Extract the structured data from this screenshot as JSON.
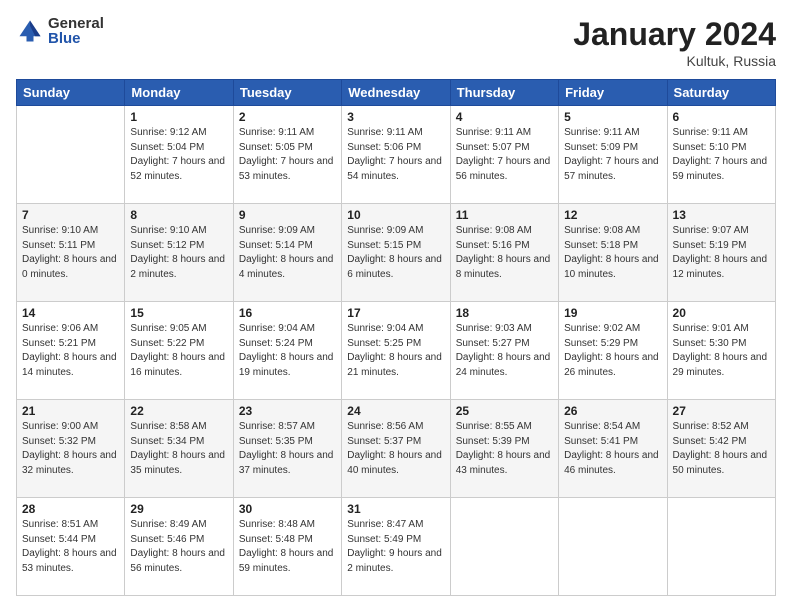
{
  "header": {
    "logo_general": "General",
    "logo_blue": "Blue",
    "month_title": "January 2024",
    "location": "Kultuk, Russia"
  },
  "days_of_week": [
    "Sunday",
    "Monday",
    "Tuesday",
    "Wednesday",
    "Thursday",
    "Friday",
    "Saturday"
  ],
  "weeks": [
    [
      {
        "day": "",
        "sunrise": "",
        "sunset": "",
        "daylight": ""
      },
      {
        "day": "1",
        "sunrise": "Sunrise: 9:12 AM",
        "sunset": "Sunset: 5:04 PM",
        "daylight": "Daylight: 7 hours and 52 minutes."
      },
      {
        "day": "2",
        "sunrise": "Sunrise: 9:11 AM",
        "sunset": "Sunset: 5:05 PM",
        "daylight": "Daylight: 7 hours and 53 minutes."
      },
      {
        "day": "3",
        "sunrise": "Sunrise: 9:11 AM",
        "sunset": "Sunset: 5:06 PM",
        "daylight": "Daylight: 7 hours and 54 minutes."
      },
      {
        "day": "4",
        "sunrise": "Sunrise: 9:11 AM",
        "sunset": "Sunset: 5:07 PM",
        "daylight": "Daylight: 7 hours and 56 minutes."
      },
      {
        "day": "5",
        "sunrise": "Sunrise: 9:11 AM",
        "sunset": "Sunset: 5:09 PM",
        "daylight": "Daylight: 7 hours and 57 minutes."
      },
      {
        "day": "6",
        "sunrise": "Sunrise: 9:11 AM",
        "sunset": "Sunset: 5:10 PM",
        "daylight": "Daylight: 7 hours and 59 minutes."
      }
    ],
    [
      {
        "day": "7",
        "sunrise": "Sunrise: 9:10 AM",
        "sunset": "Sunset: 5:11 PM",
        "daylight": "Daylight: 8 hours and 0 minutes."
      },
      {
        "day": "8",
        "sunrise": "Sunrise: 9:10 AM",
        "sunset": "Sunset: 5:12 PM",
        "daylight": "Daylight: 8 hours and 2 minutes."
      },
      {
        "day": "9",
        "sunrise": "Sunrise: 9:09 AM",
        "sunset": "Sunset: 5:14 PM",
        "daylight": "Daylight: 8 hours and 4 minutes."
      },
      {
        "day": "10",
        "sunrise": "Sunrise: 9:09 AM",
        "sunset": "Sunset: 5:15 PM",
        "daylight": "Daylight: 8 hours and 6 minutes."
      },
      {
        "day": "11",
        "sunrise": "Sunrise: 9:08 AM",
        "sunset": "Sunset: 5:16 PM",
        "daylight": "Daylight: 8 hours and 8 minutes."
      },
      {
        "day": "12",
        "sunrise": "Sunrise: 9:08 AM",
        "sunset": "Sunset: 5:18 PM",
        "daylight": "Daylight: 8 hours and 10 minutes."
      },
      {
        "day": "13",
        "sunrise": "Sunrise: 9:07 AM",
        "sunset": "Sunset: 5:19 PM",
        "daylight": "Daylight: 8 hours and 12 minutes."
      }
    ],
    [
      {
        "day": "14",
        "sunrise": "Sunrise: 9:06 AM",
        "sunset": "Sunset: 5:21 PM",
        "daylight": "Daylight: 8 hours and 14 minutes."
      },
      {
        "day": "15",
        "sunrise": "Sunrise: 9:05 AM",
        "sunset": "Sunset: 5:22 PM",
        "daylight": "Daylight: 8 hours and 16 minutes."
      },
      {
        "day": "16",
        "sunrise": "Sunrise: 9:04 AM",
        "sunset": "Sunset: 5:24 PM",
        "daylight": "Daylight: 8 hours and 19 minutes."
      },
      {
        "day": "17",
        "sunrise": "Sunrise: 9:04 AM",
        "sunset": "Sunset: 5:25 PM",
        "daylight": "Daylight: 8 hours and 21 minutes."
      },
      {
        "day": "18",
        "sunrise": "Sunrise: 9:03 AM",
        "sunset": "Sunset: 5:27 PM",
        "daylight": "Daylight: 8 hours and 24 minutes."
      },
      {
        "day": "19",
        "sunrise": "Sunrise: 9:02 AM",
        "sunset": "Sunset: 5:29 PM",
        "daylight": "Daylight: 8 hours and 26 minutes."
      },
      {
        "day": "20",
        "sunrise": "Sunrise: 9:01 AM",
        "sunset": "Sunset: 5:30 PM",
        "daylight": "Daylight: 8 hours and 29 minutes."
      }
    ],
    [
      {
        "day": "21",
        "sunrise": "Sunrise: 9:00 AM",
        "sunset": "Sunset: 5:32 PM",
        "daylight": "Daylight: 8 hours and 32 minutes."
      },
      {
        "day": "22",
        "sunrise": "Sunrise: 8:58 AM",
        "sunset": "Sunset: 5:34 PM",
        "daylight": "Daylight: 8 hours and 35 minutes."
      },
      {
        "day": "23",
        "sunrise": "Sunrise: 8:57 AM",
        "sunset": "Sunset: 5:35 PM",
        "daylight": "Daylight: 8 hours and 37 minutes."
      },
      {
        "day": "24",
        "sunrise": "Sunrise: 8:56 AM",
        "sunset": "Sunset: 5:37 PM",
        "daylight": "Daylight: 8 hours and 40 minutes."
      },
      {
        "day": "25",
        "sunrise": "Sunrise: 8:55 AM",
        "sunset": "Sunset: 5:39 PM",
        "daylight": "Daylight: 8 hours and 43 minutes."
      },
      {
        "day": "26",
        "sunrise": "Sunrise: 8:54 AM",
        "sunset": "Sunset: 5:41 PM",
        "daylight": "Daylight: 8 hours and 46 minutes."
      },
      {
        "day": "27",
        "sunrise": "Sunrise: 8:52 AM",
        "sunset": "Sunset: 5:42 PM",
        "daylight": "Daylight: 8 hours and 50 minutes."
      }
    ],
    [
      {
        "day": "28",
        "sunrise": "Sunrise: 8:51 AM",
        "sunset": "Sunset: 5:44 PM",
        "daylight": "Daylight: 8 hours and 53 minutes."
      },
      {
        "day": "29",
        "sunrise": "Sunrise: 8:49 AM",
        "sunset": "Sunset: 5:46 PM",
        "daylight": "Daylight: 8 hours and 56 minutes."
      },
      {
        "day": "30",
        "sunrise": "Sunrise: 8:48 AM",
        "sunset": "Sunset: 5:48 PM",
        "daylight": "Daylight: 8 hours and 59 minutes."
      },
      {
        "day": "31",
        "sunrise": "Sunrise: 8:47 AM",
        "sunset": "Sunset: 5:49 PM",
        "daylight": "Daylight: 9 hours and 2 minutes."
      },
      {
        "day": "",
        "sunrise": "",
        "sunset": "",
        "daylight": ""
      },
      {
        "day": "",
        "sunrise": "",
        "sunset": "",
        "daylight": ""
      },
      {
        "day": "",
        "sunrise": "",
        "sunset": "",
        "daylight": ""
      }
    ]
  ]
}
